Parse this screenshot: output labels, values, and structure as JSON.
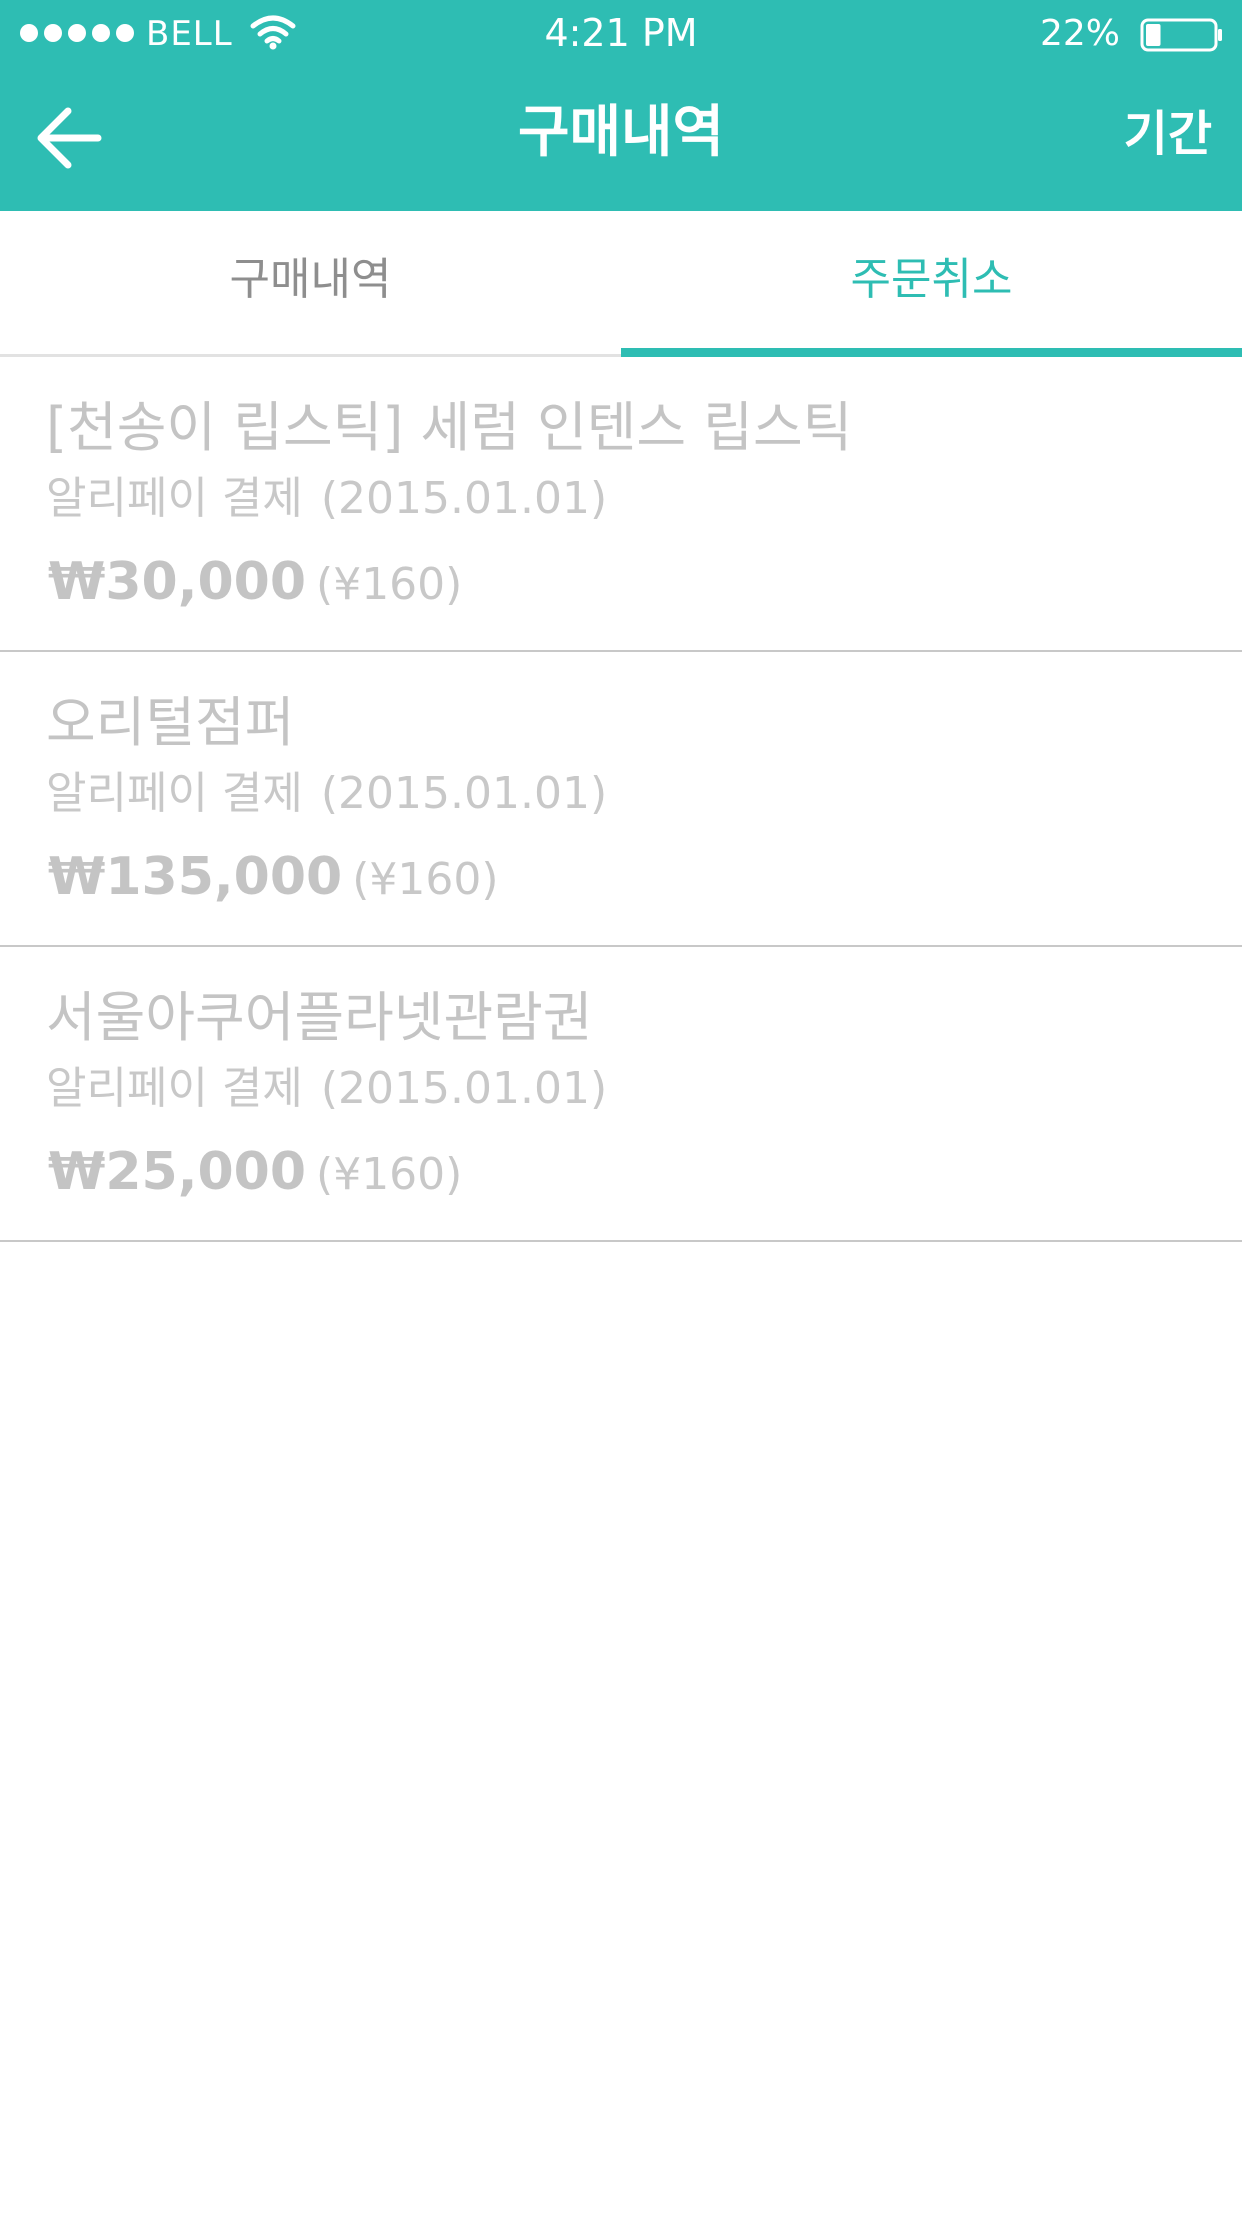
{
  "status_bar": {
    "carrier": "BELL",
    "time": "4:21 PM",
    "battery": "22%",
    "battery_level": 0.22,
    "signal_dots": 5
  },
  "nav": {
    "title": "구매내역",
    "period_label": "기간",
    "back_icon": "arrow-left-icon"
  },
  "tabs": [
    {
      "label": "구매내역",
      "active": false
    },
    {
      "label": "주문취소",
      "active": true
    }
  ],
  "orders": [
    {
      "name": "[천송이 립스틱] 세럼 인텐스 립스틱",
      "payment": "알리페이 결제",
      "date": "(2015.01.01)",
      "price": "₩30,000",
      "yen": "(¥160)"
    },
    {
      "name": "오리털점퍼",
      "payment": "알리페이 결제",
      "date": "(2015.01.01)",
      "price": "₩135,000",
      "yen": "(¥160)"
    },
    {
      "name": "서울아쿠어플라넷관람권",
      "payment": "알리페이 결제",
      "date": "(2015.01.01)",
      "price": "₩25,000",
      "yen": "(¥160)"
    }
  ],
  "colors": {
    "accent": "#2ebdb3",
    "muted_text": "#c4c4c4",
    "inactive_tab": "#8e8e8e"
  }
}
